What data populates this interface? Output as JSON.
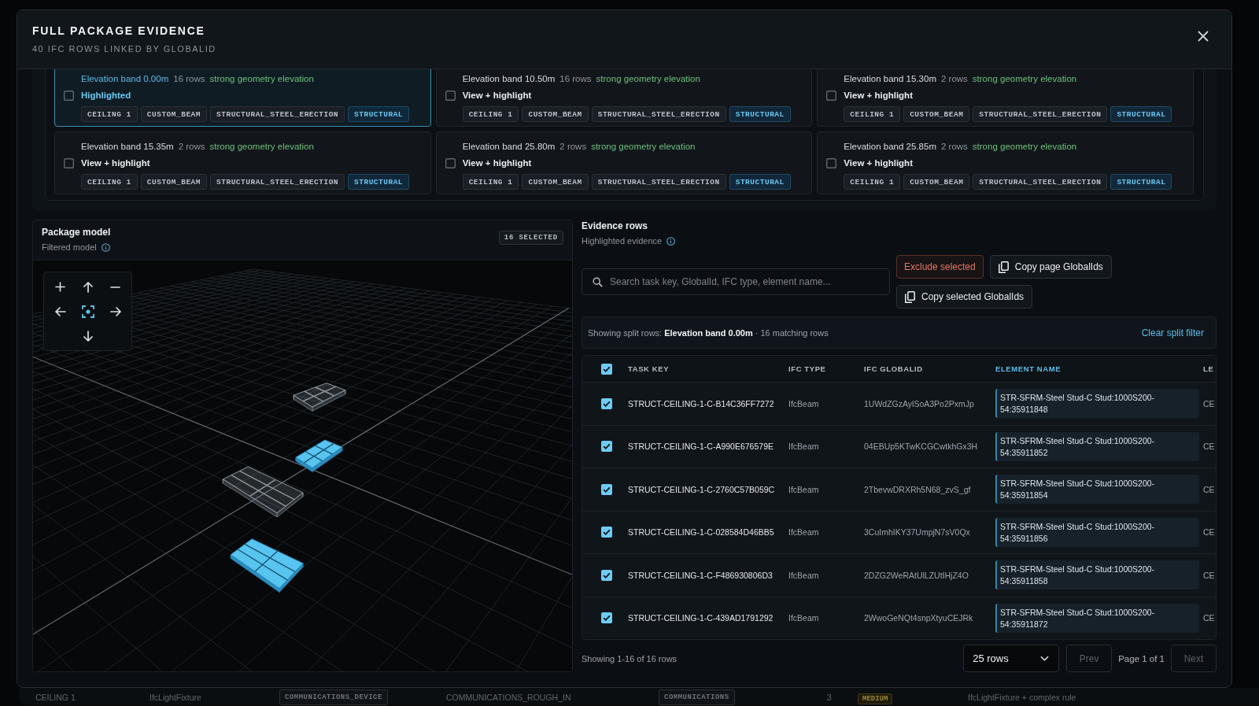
{
  "dialog": {
    "title": "FULL PACKAGE EVIDENCE",
    "subtitle": "40 IFC ROWS LINKED BY GLOBALID"
  },
  "elevation_bands": [
    {
      "title": "Elevation band 0.00m",
      "rows": "16 rows",
      "quality": "strong geometry elevation",
      "selected": true,
      "checked": false,
      "action": "Highlighted",
      "tags": [
        {
          "text": "CEILING 1",
          "kind": "scope"
        },
        {
          "text": "CUSTOM_BEAM",
          "kind": "scope"
        },
        {
          "text": "STRUCTURAL_STEEL_ERECTION",
          "kind": "scope"
        },
        {
          "text": "STRUCTURAL",
          "kind": "discipline"
        }
      ]
    },
    {
      "title": "Elevation band 10.50m",
      "rows": "16 rows",
      "quality": "strong geometry elevation",
      "selected": false,
      "checked": false,
      "action": "View + highlight",
      "tags": [
        {
          "text": "CEILING 1",
          "kind": "scope"
        },
        {
          "text": "CUSTOM_BEAM",
          "kind": "scope"
        },
        {
          "text": "STRUCTURAL_STEEL_ERECTION",
          "kind": "scope"
        },
        {
          "text": "STRUCTURAL",
          "kind": "discipline"
        }
      ]
    },
    {
      "title": "Elevation band 15.30m",
      "rows": "2 rows",
      "quality": "strong geometry elevation",
      "selected": false,
      "checked": false,
      "action": "View + highlight",
      "tags": [
        {
          "text": "CEILING 1",
          "kind": "scope"
        },
        {
          "text": "CUSTOM_BEAM",
          "kind": "scope"
        },
        {
          "text": "STRUCTURAL_STEEL_ERECTION",
          "kind": "scope"
        },
        {
          "text": "STRUCTURAL",
          "kind": "discipline"
        }
      ]
    },
    {
      "title": "Elevation band 15.35m",
      "rows": "2 rows",
      "quality": "strong geometry elevation",
      "selected": false,
      "checked": false,
      "action": "View + highlight",
      "tags": [
        {
          "text": "CEILING 1",
          "kind": "scope"
        },
        {
          "text": "CUSTOM_BEAM",
          "kind": "scope"
        },
        {
          "text": "STRUCTURAL_STEEL_ERECTION",
          "kind": "scope"
        },
        {
          "text": "STRUCTURAL",
          "kind": "discipline"
        }
      ]
    },
    {
      "title": "Elevation band 25.80m",
      "rows": "2 rows",
      "quality": "strong geometry elevation",
      "selected": false,
      "checked": false,
      "action": "View + highlight",
      "tags": [
        {
          "text": "CEILING 1",
          "kind": "scope"
        },
        {
          "text": "CUSTOM_BEAM",
          "kind": "scope"
        },
        {
          "text": "STRUCTURAL_STEEL_ERECTION",
          "kind": "scope"
        },
        {
          "text": "STRUCTURAL",
          "kind": "discipline"
        }
      ]
    },
    {
      "title": "Elevation band 25.85m",
      "rows": "2 rows",
      "quality": "strong geometry elevation",
      "selected": false,
      "checked": false,
      "action": "View + highlight",
      "tags": [
        {
          "text": "CEILING 1",
          "kind": "scope"
        },
        {
          "text": "CUSTOM_BEAM",
          "kind": "scope"
        },
        {
          "text": "STRUCTURAL_STEEL_ERECTION",
          "kind": "scope"
        },
        {
          "text": "STRUCTURAL",
          "kind": "discipline"
        }
      ]
    }
  ],
  "package_model": {
    "title": "Package model",
    "subtitle": "Filtered model",
    "badge": "16 SELECTED"
  },
  "evidence": {
    "title": "Evidence rows",
    "subtitle": "Highlighted evidence",
    "search": {
      "placeholder": "Search task key, GlobalId, IFC type, element name..."
    },
    "buttons": [
      {
        "label": "Exclude selected",
        "kind": "exclude"
      },
      {
        "label": "Copy page GlobalIds",
        "kind": "copy"
      },
      {
        "label": "Copy selected GlobalIds",
        "kind": "copy"
      }
    ],
    "split_filter": {
      "text": "Showing split rows: **Elevation band 0.00m** · 16 matching rows",
      "action": "Clear split filter"
    },
    "table": {
      "all_checked": true,
      "columns": [
        {
          "label": "TASK KEY",
          "kind": "strong",
          "sorted": false
        },
        {
          "label": "IFC TYPE",
          "kind": "muted",
          "sorted": false
        },
        {
          "label": "IFC GLOBALID",
          "kind": "muted",
          "sorted": false
        },
        {
          "label": "ELEMENT NAME",
          "kind": "boxed",
          "sorted": true
        },
        {
          "label": "LE",
          "kind": "muted",
          "sorted": false
        }
      ],
      "rows": [
        {
          "checked": true,
          "cells": [
            "STRUCT-CEILING-1-C-B14C36FF7272",
            "IfcBeam",
            "1UWdZGzAylSoA3Po2PxmJp",
            "STR-SFRM-Steel Stud-C Stud:1000S200-54:35911848",
            "CE"
          ]
        },
        {
          "checked": true,
          "cells": [
            "STRUCT-CEILING-1-C-A990E676579E",
            "IfcBeam",
            "04EBUp5KTwKCGCwtkhGx3H",
            "STR-SFRM-Steel Stud-C Stud:1000S200-54:35911852",
            "CE"
          ]
        },
        {
          "checked": true,
          "cells": [
            "STRUCT-CEILING-1-C-2760C57B059C",
            "IfcBeam",
            "2TbevwDRXRh5N68_zvS_gf",
            "STR-SFRM-Steel Stud-C Stud:1000S200-54:35911854",
            "CE"
          ]
        },
        {
          "checked": true,
          "cells": [
            "STRUCT-CEILING-1-C-028584D46BB5",
            "IfcBeam",
            "3CuImhIKY37UmpjN7sV0Qx",
            "STR-SFRM-Steel Stud-C Stud:1000S200-54:35911856",
            "CE"
          ]
        },
        {
          "checked": true,
          "cells": [
            "STRUCT-CEILING-1-C-F486930806D3",
            "IfcBeam",
            "2DZG2WeRAtUlLZUtIHjZ4O",
            "STR-SFRM-Steel Stud-C Stud:1000S200-54:35911858",
            "CE"
          ]
        },
        {
          "checked": true,
          "cells": [
            "STRUCT-CEILING-1-C-439AD1791292",
            "IfcBeam",
            "2WwoGeNQt4snpXtyuCEJRk",
            "STR-SFRM-Steel Stud-C Stud:1000S200-54:35911872",
            "CE"
          ]
        }
      ]
    },
    "footer": {
      "summary": "Showing 1-16 of 16 rows",
      "page_size": "25 rows",
      "prev": {
        "label": "Prev",
        "disabled": true
      },
      "page": "Page 1 of 1",
      "next": {
        "label": "Next",
        "disabled": true
      }
    }
  },
  "background_row": [
    {
      "text": "CEILING 1",
      "kind": "text"
    },
    {
      "text": "IfcLightFixture",
      "kind": "text"
    },
    {
      "text": "COMMUNICATIONS_DEVICE",
      "kind": "tag"
    },
    {
      "text": "COMMUNICATIONS_ROUGH_IN",
      "kind": "text"
    },
    {
      "text": "COMMUNICATIONS",
      "kind": "tag"
    },
    {
      "text": "3",
      "kind": "text"
    },
    {
      "text": "MEDIUM",
      "kind": "priority"
    },
    {
      "text": "IfcLightFixture + complex rule",
      "kind": "text"
    }
  ]
}
